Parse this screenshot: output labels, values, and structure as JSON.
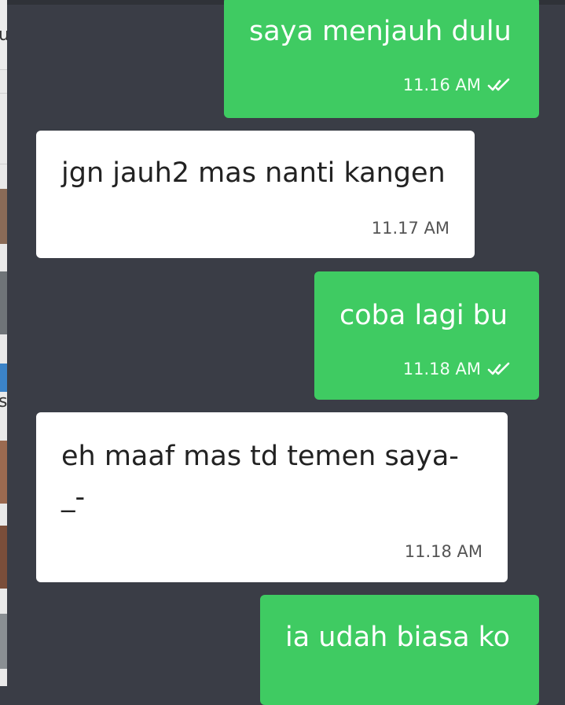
{
  "left_panel": {
    "fragments": [
      "u",
      "s"
    ]
  },
  "messages": [
    {
      "direction": "out",
      "text": "saya menjauh dulu",
      "time": "11.16 AM",
      "status": "read"
    },
    {
      "direction": "in",
      "text": "jgn jauh2 mas nanti kangen",
      "time": "11.17 AM"
    },
    {
      "direction": "out",
      "text": "coba lagi bu",
      "time": "11.18 AM",
      "status": "read"
    },
    {
      "direction": "in",
      "text": "eh maaf mas td temen saya-\n_-",
      "time": "11.18 AM"
    },
    {
      "direction": "out",
      "text": "ia udah biasa ko",
      "time": "",
      "status": "read"
    }
  ],
  "colors": {
    "background": "#3a3d46",
    "outgoing_bubble": "#3fcb62",
    "incoming_bubble": "#ffffff"
  },
  "icons": {
    "read_receipt": "double-check-icon"
  }
}
